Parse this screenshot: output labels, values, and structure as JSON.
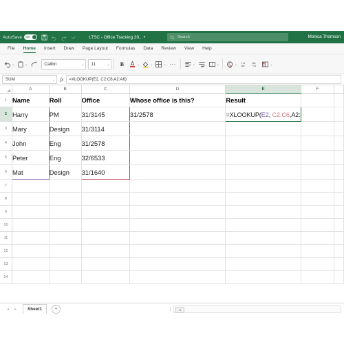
{
  "titlebar": {
    "autosave_label": "AutoSave",
    "autosave_state": "On",
    "document_title": "LTSC - Office Tracking 20..",
    "title_caret": "▾",
    "search_placeholder": "Search",
    "user_name": "Monica Thomson",
    "brand_color": "#217346",
    "icons": [
      "save-icon",
      "undo-icon",
      "redo-icon",
      "customize-icon",
      "search-icon"
    ]
  },
  "ribbon": {
    "tabs": [
      {
        "label": "File",
        "active": false
      },
      {
        "label": "Home",
        "active": true
      },
      {
        "label": "Insert",
        "active": false
      },
      {
        "label": "Draw",
        "active": false
      },
      {
        "label": "Page Layout",
        "active": false
      },
      {
        "label": "Formulas",
        "active": false
      },
      {
        "label": "Data",
        "active": false
      },
      {
        "label": "Review",
        "active": false
      },
      {
        "label": "View",
        "active": false
      },
      {
        "label": "Help",
        "active": false
      }
    ],
    "font_name": "Calibri",
    "font_size": "11",
    "bold_label": "B",
    "caret": "⌄",
    "ellipsis": "···",
    "buttons": [
      "undo-icon",
      "paste-icon",
      "format-painter-icon",
      "font-color-icon",
      "fill-color-icon",
      "borders-icon",
      "more-options-icon",
      "align-icon",
      "wrap-text-icon",
      "merge-cells-icon",
      "number-format-icon",
      "increase-decimal-icon",
      "decrease-decimal-icon",
      "conditional-formatting-icon"
    ]
  },
  "formula_bar": {
    "name_box": "SUM",
    "fx_label": "fx",
    "formula": "=XLOOKUP(E2, C2:C6,A2:A6)",
    "caret": "⌄"
  },
  "grid": {
    "columns": [
      "A",
      "B",
      "C",
      "D",
      "E",
      "F"
    ],
    "selected_column": "E",
    "rows": [
      "1",
      "2",
      "3",
      "4",
      "5",
      "6",
      "7",
      "8",
      "9",
      "10",
      "11",
      "12",
      "13",
      "14"
    ],
    "selected_row": "2",
    "headers": {
      "a": "Name",
      "b": "Roll",
      "c": "Office",
      "d": "Whose office is this?",
      "e": "Result"
    },
    "records": [
      {
        "name": "Harry",
        "roll": "PM",
        "office": "31/3145"
      },
      {
        "name": "Mary",
        "roll": "Design",
        "office": "31/3114"
      },
      {
        "name": "John",
        "roll": "Eng",
        "office": "31/2578"
      },
      {
        "name": "Peter",
        "roll": "Eng",
        "office": "32/6533"
      },
      {
        "name": "Mat",
        "roll": "Design",
        "office": "31/1640"
      }
    ],
    "lookup_value": "31/2578",
    "active_cell": "E2",
    "active_cell_formula": {
      "prefix": "=XLOOKUP(",
      "arg1": "E2",
      "sep1": ", ",
      "arg2": "C2:C6",
      "sep2": ",",
      "arg3": "A2:"
    },
    "highlight_purple": "#e9e4f2",
    "highlight_purple_border": "#7a5ea8",
    "highlight_pink": "#f8dde1",
    "highlight_pink_border": "#c0394b",
    "active_border": "#217346"
  },
  "sheetbar": {
    "prev_arrow": "◂",
    "next_arrow": "▸",
    "sheet_name": "Sheet1",
    "add_sheet": "+",
    "scroll_thumb": "◂"
  }
}
